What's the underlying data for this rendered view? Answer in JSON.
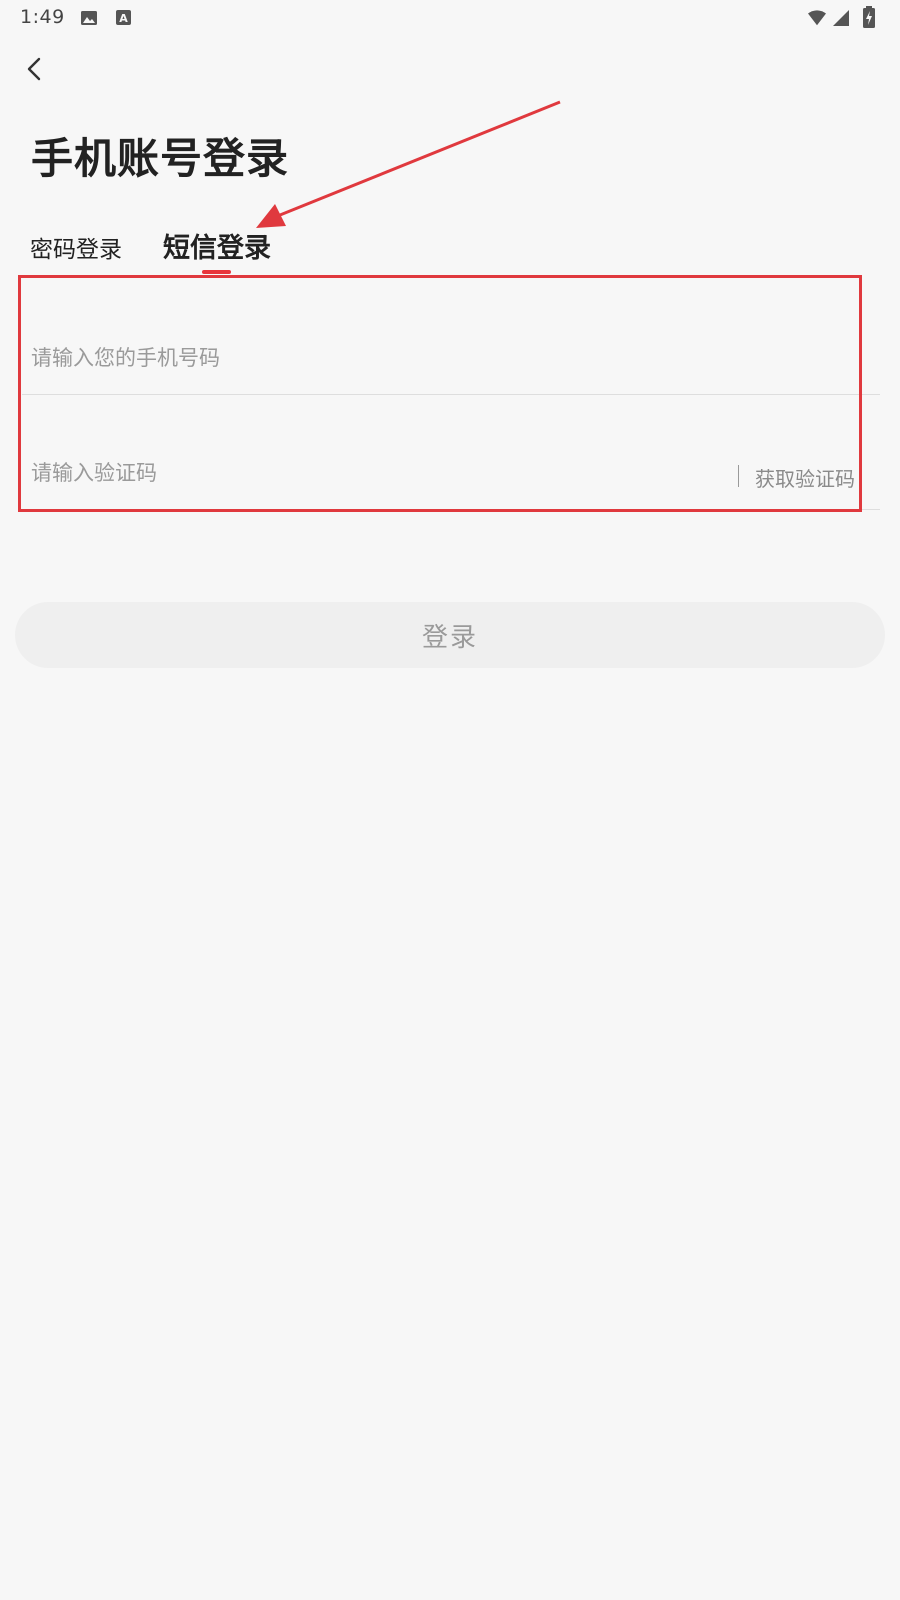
{
  "status_bar": {
    "time": "1:49",
    "icons": [
      "gallery-icon",
      "a-icon",
      "wifi-icon",
      "signal-icon",
      "battery-charging-icon"
    ]
  },
  "header": {
    "back_icon": "chevron-left-icon",
    "title": "手机账号登录"
  },
  "tabs": [
    {
      "label": "密码登录",
      "active": false
    },
    {
      "label": "短信登录",
      "active": true
    }
  ],
  "form": {
    "phone_placeholder": "请输入您的手机号码",
    "phone_value": "",
    "code_placeholder": "请输入验证码",
    "code_value": "",
    "get_code_label": "获取验证码"
  },
  "login_button_label": "登录",
  "colors": {
    "accent": "#e8353b",
    "annotation": "#e0393e",
    "background": "#f7f7f7",
    "button_bg": "#efefef",
    "placeholder": "#9a9a9a"
  }
}
